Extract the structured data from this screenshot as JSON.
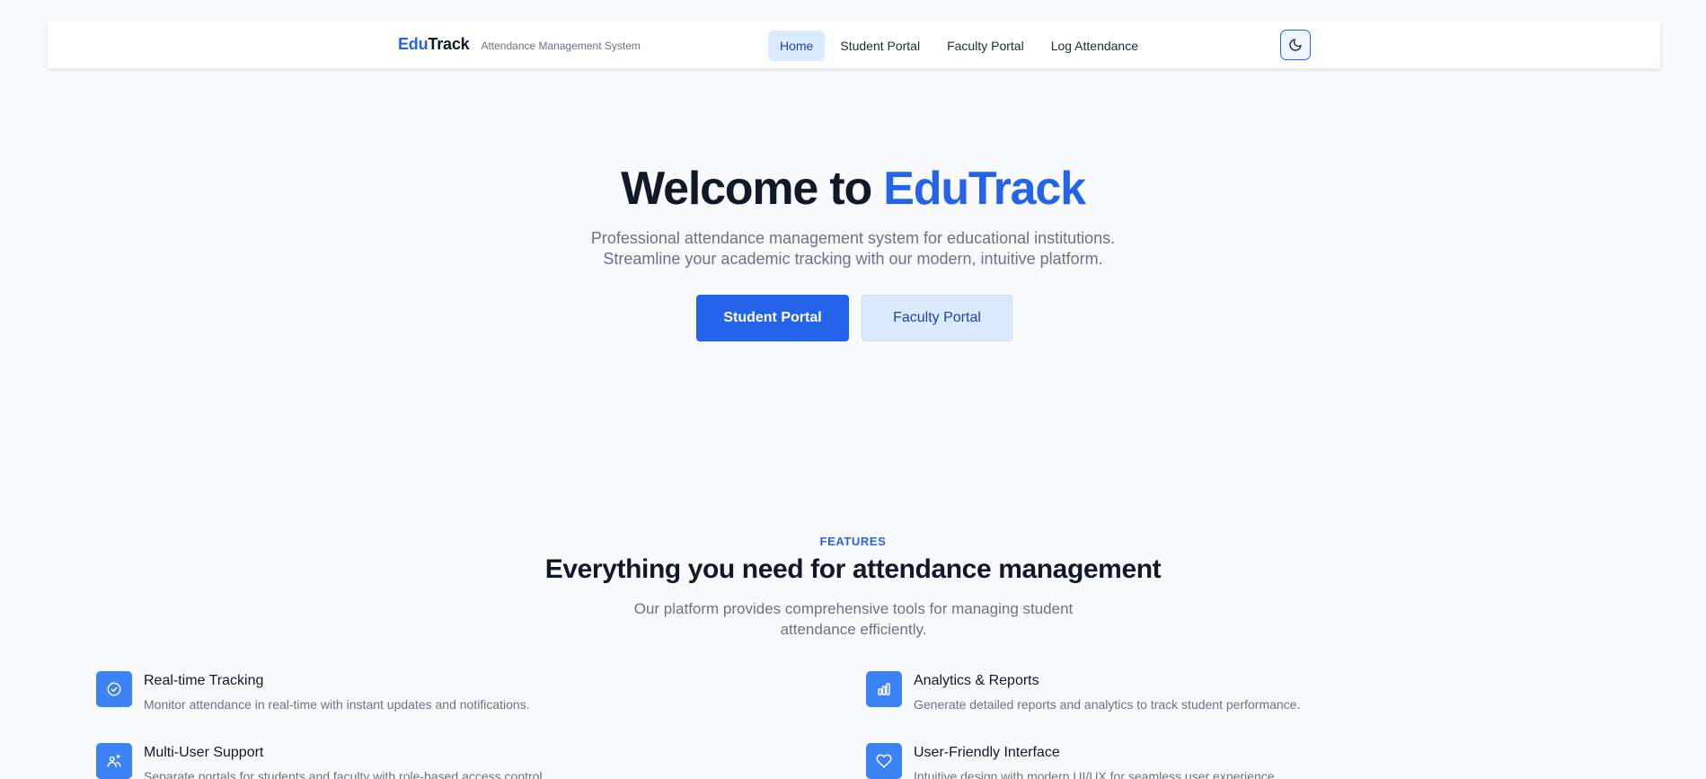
{
  "navbar": {
    "brand_edu": "Edu",
    "brand_track": "Track",
    "tagline": "Attendance Management System",
    "links": [
      {
        "label": "Home",
        "active": true
      },
      {
        "label": "Student Portal",
        "active": false
      },
      {
        "label": "Faculty Portal",
        "active": false
      },
      {
        "label": "Log Attendance",
        "active": false
      }
    ],
    "theme_toggle_icon": "moon-icon"
  },
  "hero": {
    "title_prefix": "Welcome to ",
    "title_accent": "EduTrack",
    "subtitle_line1": "Professional attendance management system for educational institutions.",
    "subtitle_line2": "Streamline your academic tracking with our modern, intuitive platform.",
    "primary_button": "Student Portal",
    "secondary_button": "Faculty Portal"
  },
  "features": {
    "eyebrow": "FEATURES",
    "title": "Everything you need for attendance management",
    "subtitle": "Our platform provides comprehensive tools for managing student attendance efficiently.",
    "items": [
      {
        "icon": "check-circle-icon",
        "title": "Real-time Tracking",
        "description": "Monitor attendance in real-time with instant updates and notifications."
      },
      {
        "icon": "bar-chart-icon",
        "title": "Analytics & Reports",
        "description": "Generate detailed reports and analytics to track student performance."
      },
      {
        "icon": "users-icon",
        "title": "Multi-User Support",
        "description": "Separate portals for students and faculty with role-based access control."
      },
      {
        "icon": "heart-icon",
        "title": "User-Friendly Interface",
        "description": "Intuitive design with modern UI/UX for seamless user experience."
      }
    ]
  },
  "colors": {
    "accent": "#2563eb",
    "accent_light": "#dbeafe",
    "background": "#f8fafc",
    "icon_bg": "#3b82f6"
  }
}
